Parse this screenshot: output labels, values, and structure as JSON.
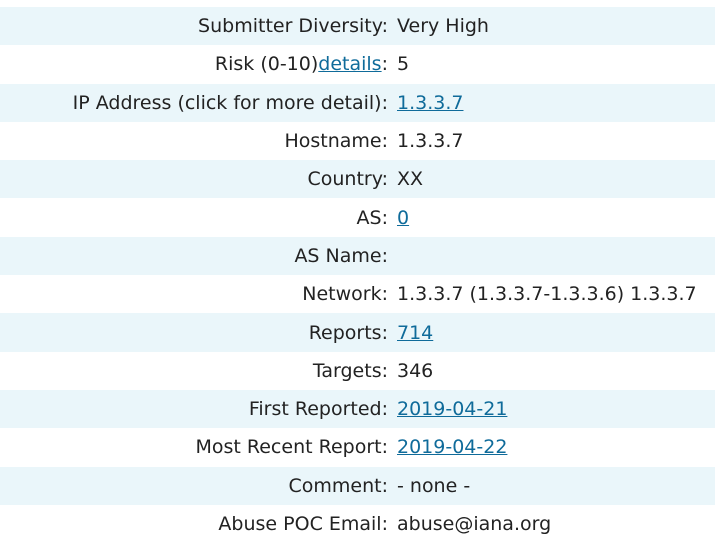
{
  "rows": [
    {
      "label": "Submitter Diversity",
      "value": "Very High"
    },
    {
      "label": "Risk (0-10)",
      "label_link": "details",
      "value": "5"
    },
    {
      "label": "IP Address (click for more detail)",
      "value": "1.3.3.7"
    },
    {
      "label": "Hostname",
      "value": "1.3.3.7"
    },
    {
      "label": "Country",
      "value": "XX"
    },
    {
      "label": "AS",
      "value": "0"
    },
    {
      "label": "AS Name",
      "value": ""
    },
    {
      "label": "Network",
      "value": "1.3.3.7 (1.3.3.7-1.3.3.6) 1.3.3.7"
    },
    {
      "label": "Reports",
      "value": "714"
    },
    {
      "label": "Targets",
      "value": "346"
    },
    {
      "label": "First Reported",
      "value": "2019-04-21"
    },
    {
      "label": "Most Recent Report",
      "value": "2019-04-22"
    },
    {
      "label": "Comment",
      "value": "- none -"
    },
    {
      "label": "Abuse POC Email",
      "value": "abuse@iana.org"
    }
  ],
  "separator": ":"
}
